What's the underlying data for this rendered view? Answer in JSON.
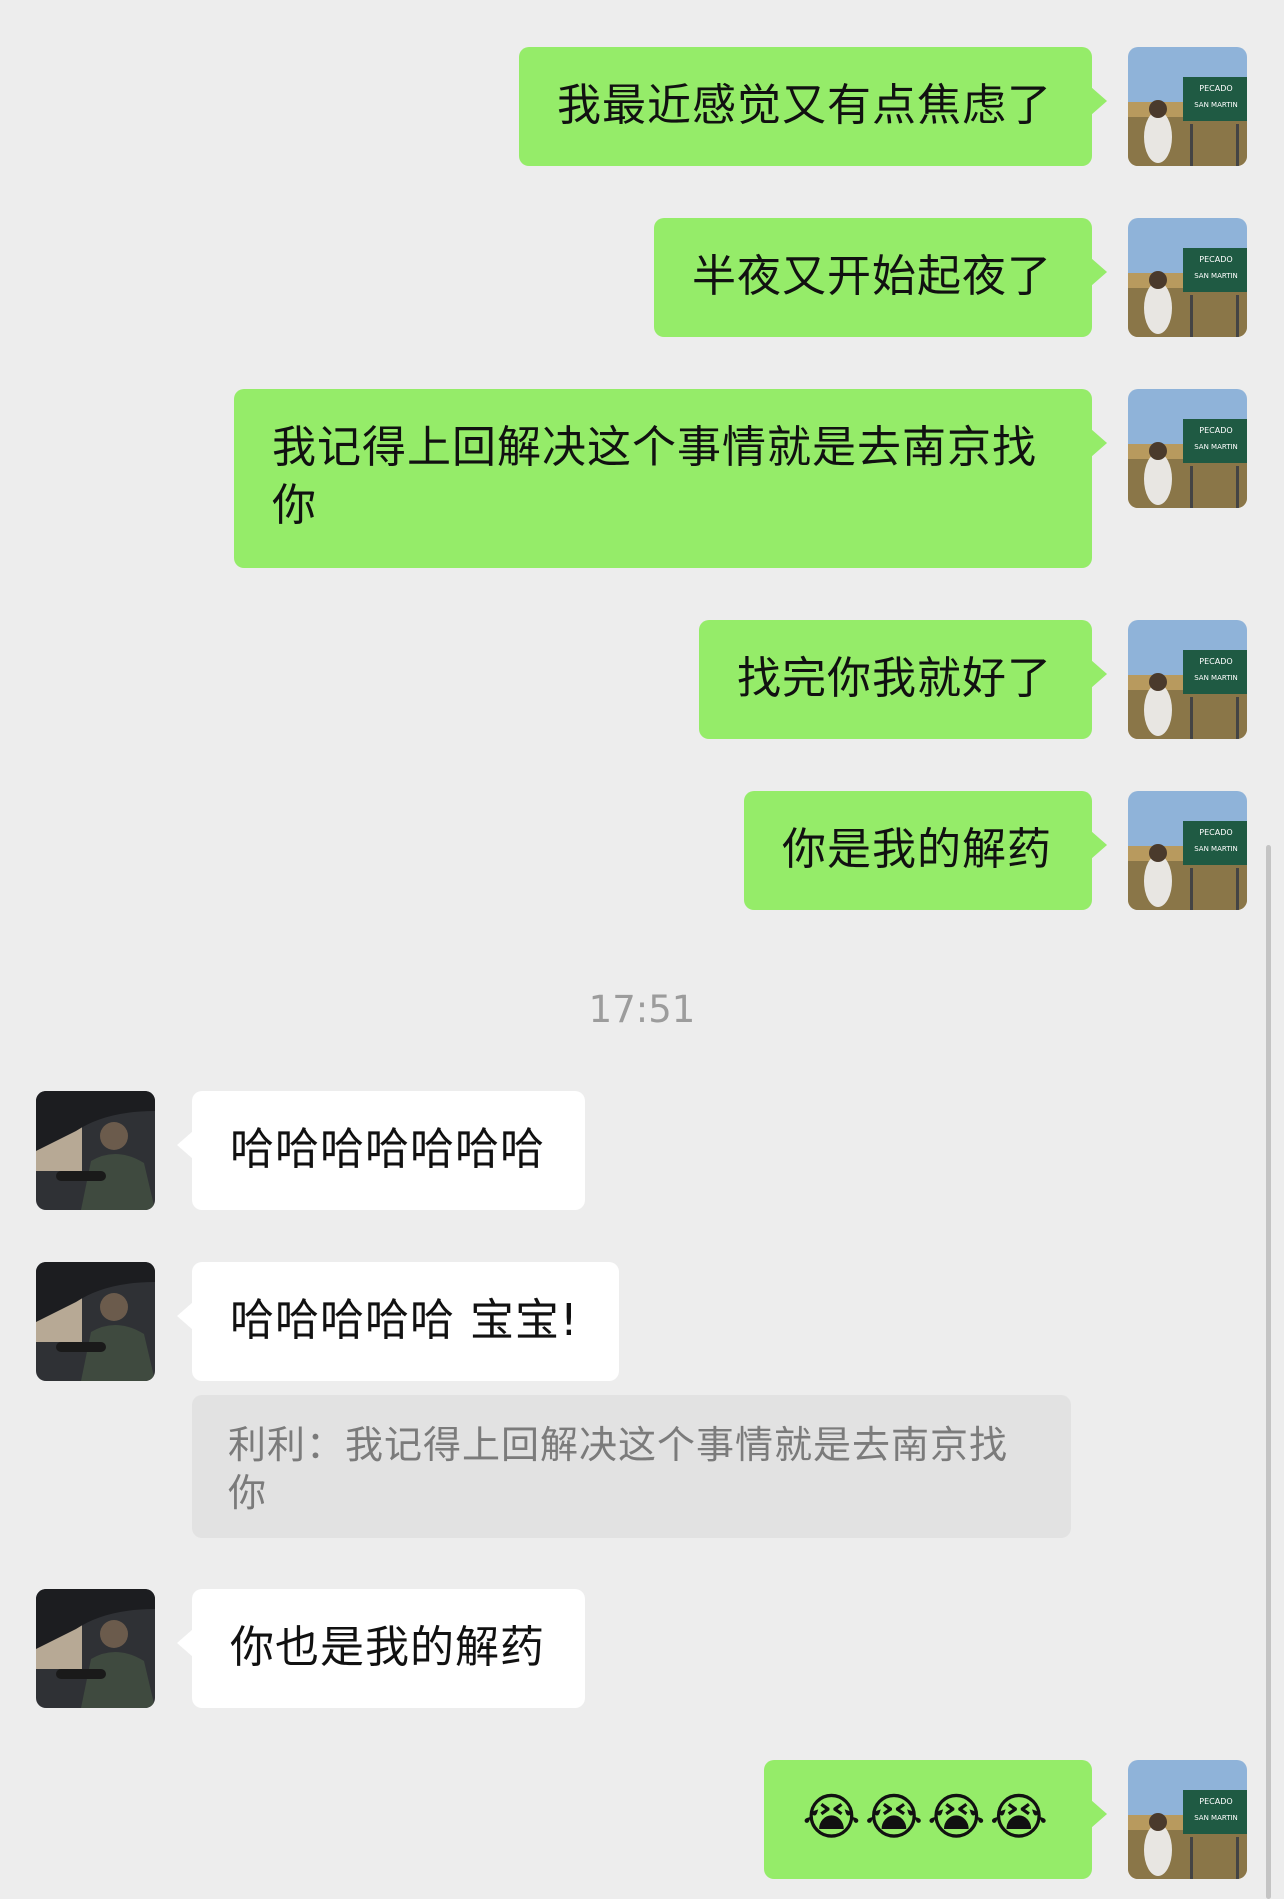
{
  "conversation": {
    "timestamp": "17:51",
    "messages": [
      {
        "from": "me",
        "text": "我最近感觉又有点焦虑了"
      },
      {
        "from": "me",
        "text": "半夜又开始起夜了"
      },
      {
        "from": "me",
        "text": "我记得上回解决这个事情就是去南京找你"
      },
      {
        "from": "me",
        "text": "找完你我就好了"
      },
      {
        "from": "me",
        "text": "你是我的解药"
      },
      {
        "from": "them",
        "text": "哈哈哈哈哈哈哈"
      },
      {
        "from": "them",
        "text": "哈哈哈哈哈 宝宝!"
      },
      {
        "from": "them",
        "text": "你也是我的解药"
      },
      {
        "from": "me",
        "text": "😭😭😭😭"
      }
    ],
    "quote": {
      "text": "利利：我记得上回解决这个事情就是去南京找你"
    }
  },
  "avatars": {
    "me": {
      "icon": "avatar-roadsign-photo",
      "sign_line1": "PECADO",
      "sign_line2": "SAN MARTIN"
    },
    "them": {
      "icon": "avatar-car-driver-photo"
    }
  }
}
